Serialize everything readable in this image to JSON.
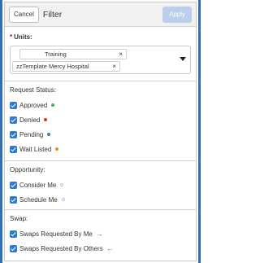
{
  "header": {
    "cancel_label": "Cancel",
    "title": "Filter",
    "apply_label": "Apply"
  },
  "units": {
    "required_mark": "*",
    "label": "Units:",
    "selected": [
      {
        "label": "Training",
        "remove": "×"
      },
      {
        "label": "zzTemplate Mercy Hospital",
        "remove": "×"
      }
    ]
  },
  "request_status": {
    "title": "Request Status:",
    "items": [
      {
        "label": "Approved",
        "checked": true,
        "color": "#3fb34f"
      },
      {
        "label": "Denied",
        "checked": true,
        "color": "#d9302c"
      },
      {
        "label": "Pending",
        "checked": true,
        "color": "#3a7fd0"
      },
      {
        "label": "Wait Listed",
        "checked": true,
        "color": "#f08a24"
      }
    ]
  },
  "opportunity": {
    "title": "Opportunity:",
    "items": [
      {
        "label": "Consider Me",
        "checked": true,
        "color": "#a9c6e8"
      },
      {
        "label": "Schedule Me",
        "checked": true,
        "color": "#a9c6e8"
      }
    ]
  },
  "swap": {
    "title": "Swap:",
    "items": [
      {
        "label": "Swaps Requested By Me",
        "checked": true,
        "icon": "→",
        "color": "#2d7ad4"
      },
      {
        "label": "Swaps Requested By Others",
        "checked": true,
        "icon": "←",
        "color": "#2d7ad4"
      }
    ]
  },
  "colors": {
    "accent": "#2d7ad4",
    "apply_disabled": "#b9cfea",
    "window_edge": "#2f6fb6"
  }
}
